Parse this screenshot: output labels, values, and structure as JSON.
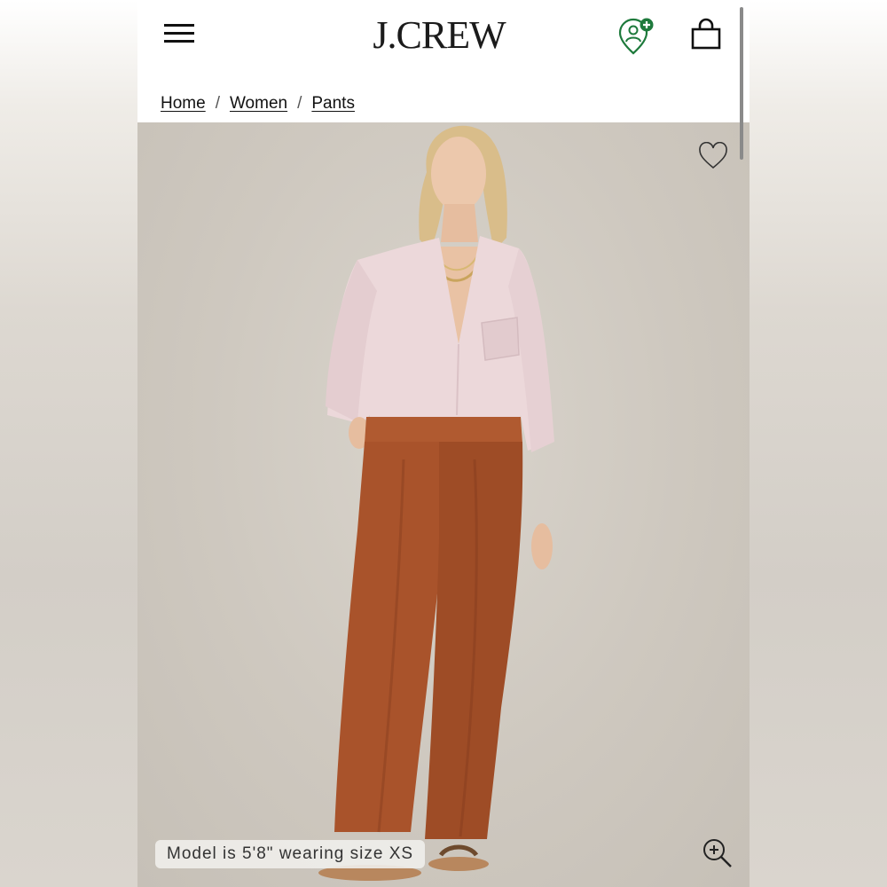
{
  "header": {
    "menu_icon": "hamburger-menu-icon",
    "logo": "J.CREW",
    "rewards_icon": "rewards-profile-icon",
    "bag_icon": "shopping-bag-icon"
  },
  "breadcrumb": [
    {
      "label": "Home"
    },
    {
      "label": "Women"
    },
    {
      "label": "Pants"
    }
  ],
  "breadcrumb_separator": "/",
  "product_image": {
    "wishlist_icon": "heart-icon",
    "zoom_icon": "zoom-in-icon",
    "caption": "Model is 5'8\" wearing size XS"
  },
  "colors": {
    "brand_text": "#1b1b1b",
    "rewards_green": "#1e7a3c",
    "pants": "#a9532b",
    "shirt": "#ecd8da",
    "backdrop": "#d1ccc5"
  }
}
